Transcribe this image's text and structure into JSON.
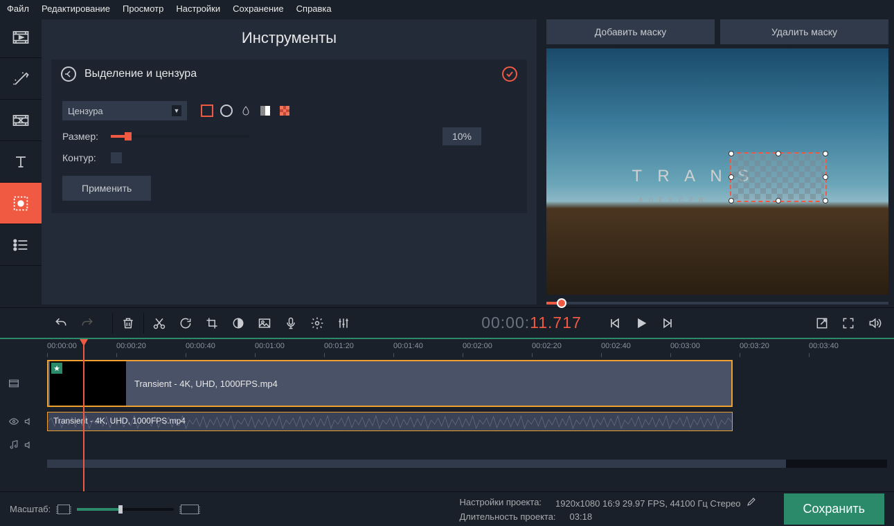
{
  "menubar": [
    "Файл",
    "Редактирование",
    "Просмотр",
    "Настройки",
    "Сохранение",
    "Справка"
  ],
  "tools": {
    "title": "Инструменты",
    "section_title": "Выделение и цензура",
    "dropdown": "Цензура",
    "size_label": "Размер:",
    "size_value": "10%",
    "outline_label": "Контур:",
    "apply": "Применить"
  },
  "preview": {
    "add_mask": "Добавить маску",
    "del_mask": "Удалить маску",
    "overlay_text": "T R A N S",
    "overlay_sub": "A  D F V C  P R"
  },
  "timecode": {
    "gray": "00:00:",
    "orange": "11.717"
  },
  "ruler": [
    "00:00:00",
    "00:00:20",
    "00:00:40",
    "00:01:00",
    "00:01:20",
    "00:01:40",
    "00:02:00",
    "00:02:20",
    "00:02:40",
    "00:03:00",
    "00:03:20",
    "00:03:40"
  ],
  "clip_name": "Transient - 4K, UHD, 1000FPS.mp4",
  "status": {
    "zoom_label": "Масштаб:",
    "proj_label": "Настройки проекта:",
    "proj_value": "1920x1080 16:9 29.97 FPS, 44100 Гц Стерео",
    "dur_label": "Длительность проекта:",
    "dur_value": "03:18",
    "save": "Сохранить"
  }
}
